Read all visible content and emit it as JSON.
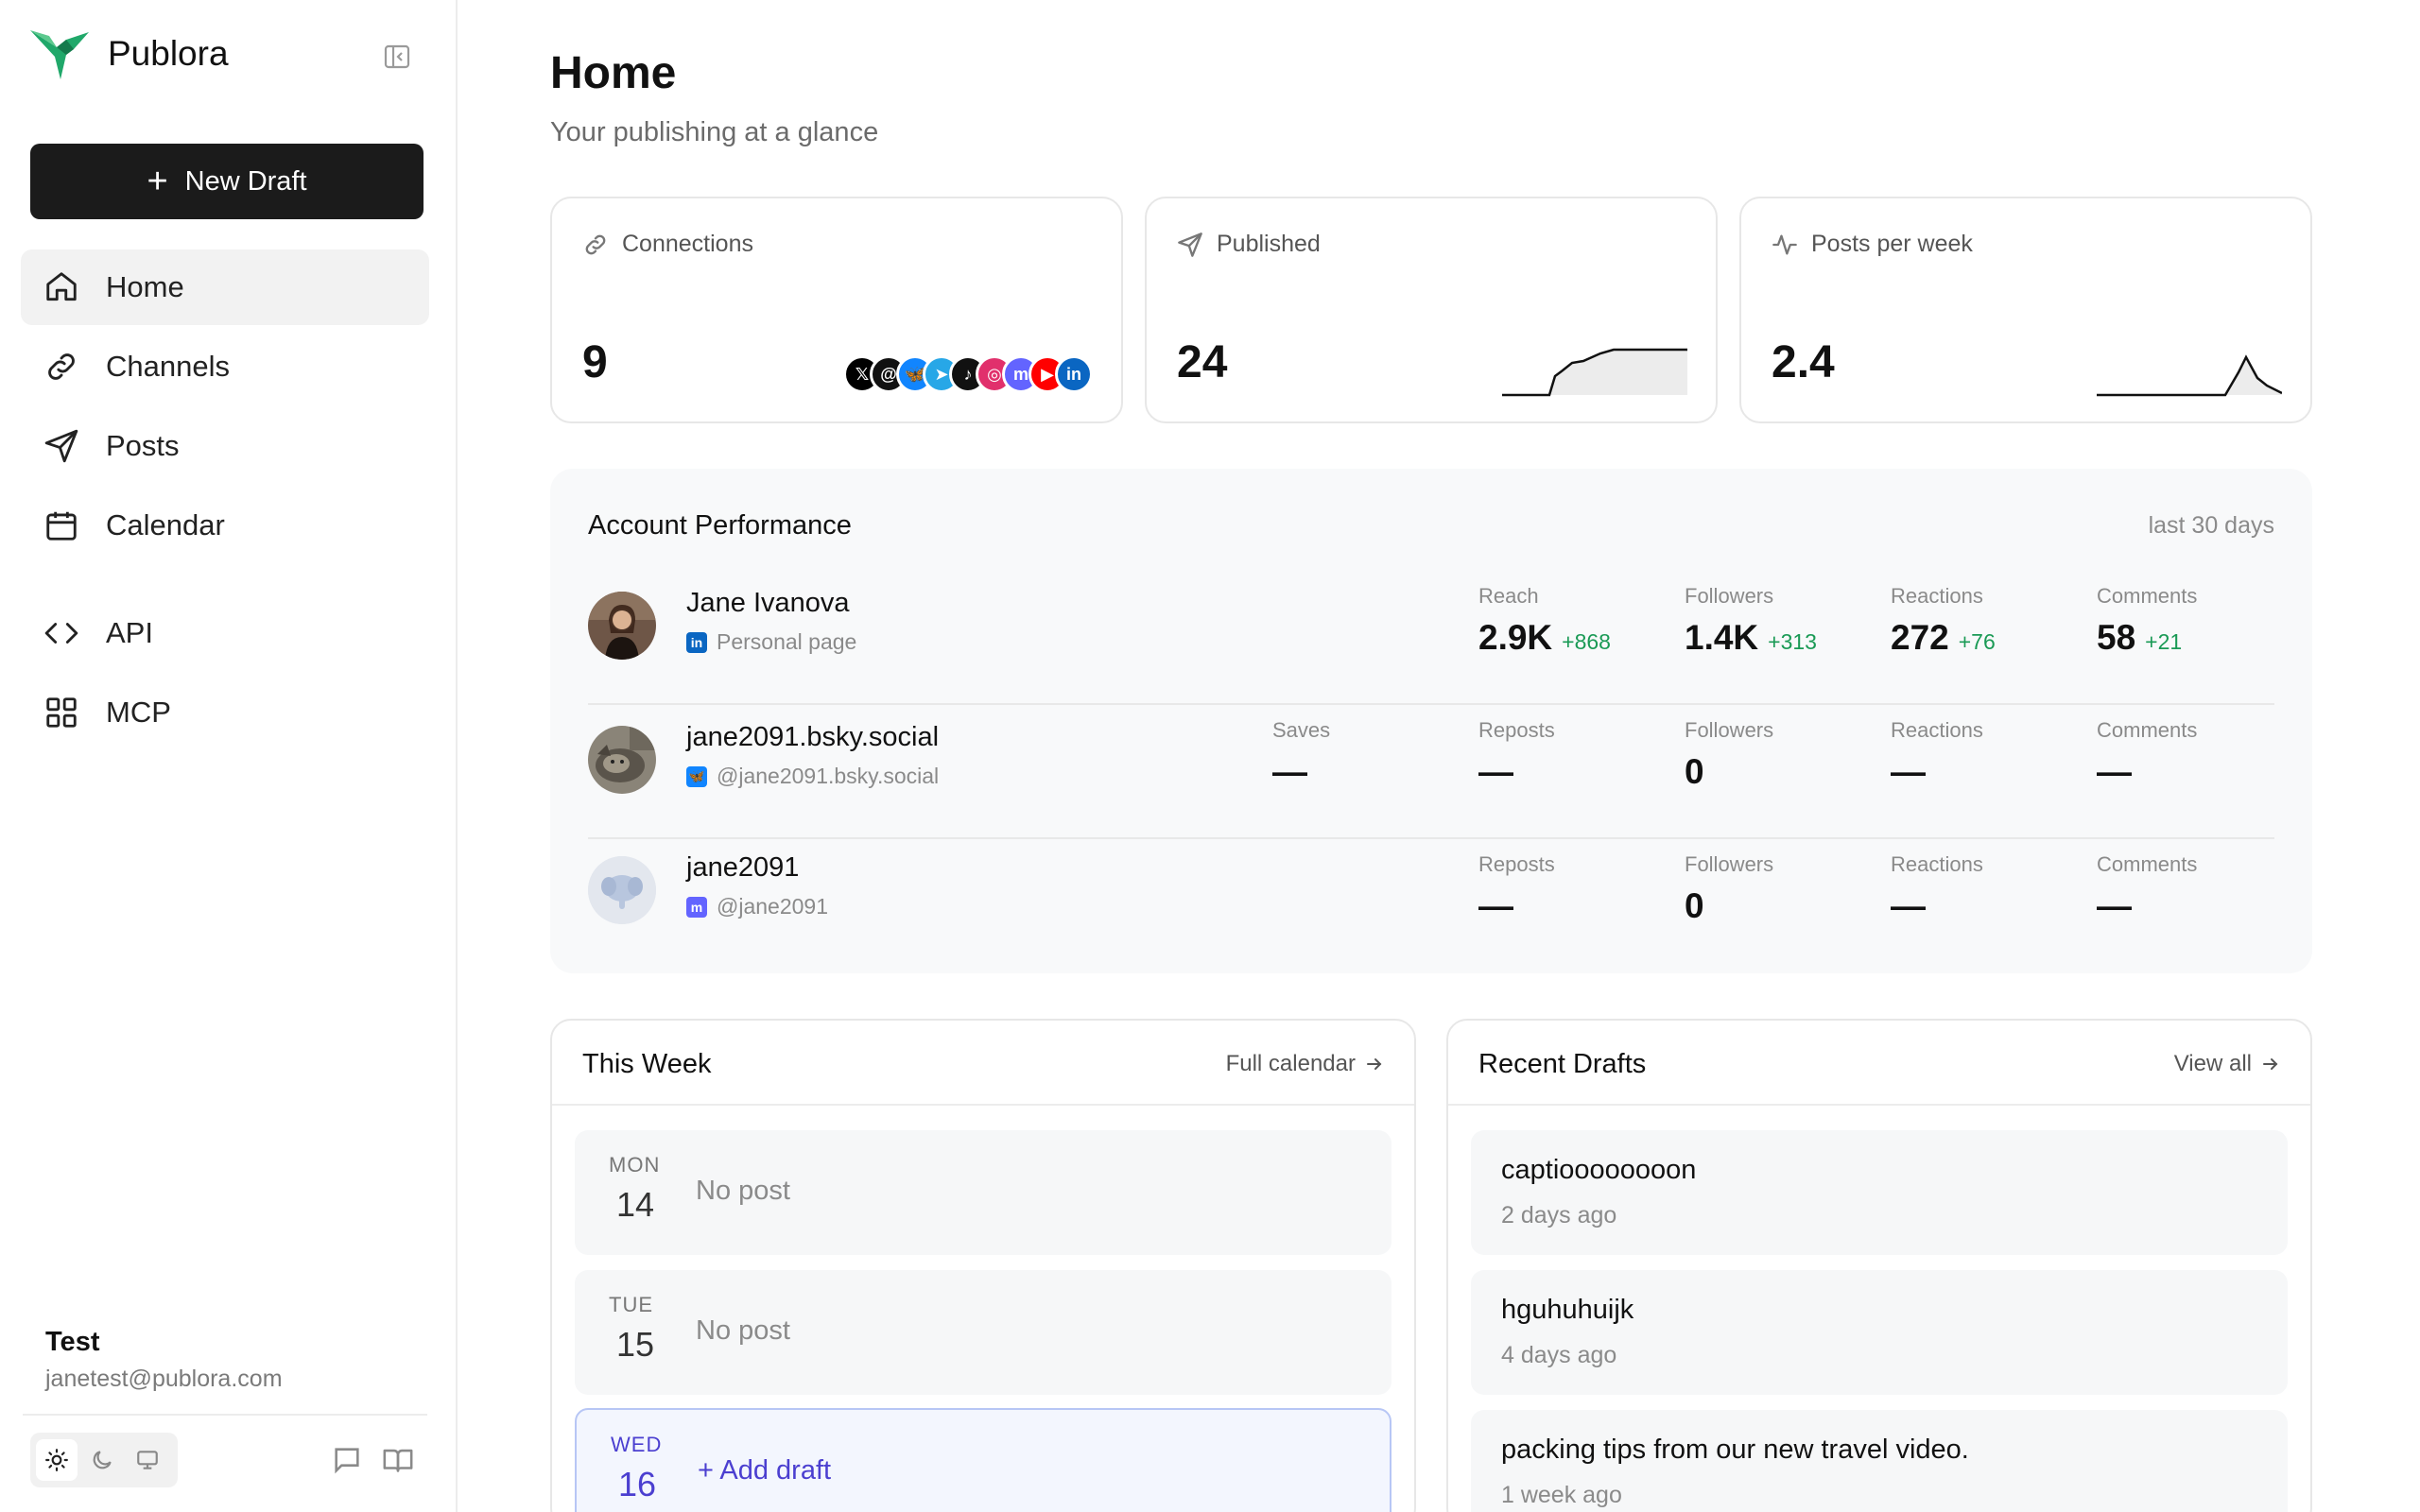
{
  "brand": {
    "name": "Publora"
  },
  "sidebar": {
    "new_draft_label": "New Draft",
    "nav": [
      {
        "label": "Home",
        "icon": "home-icon"
      },
      {
        "label": "Channels",
        "icon": "link-icon"
      },
      {
        "label": "Posts",
        "icon": "send-icon"
      },
      {
        "label": "Calendar",
        "icon": "calendar-icon"
      },
      {
        "label": "API",
        "icon": "code-icon"
      },
      {
        "label": "MCP",
        "icon": "grid-icon"
      }
    ],
    "user": {
      "name": "Test",
      "email": "janetest@publora.com"
    }
  },
  "header": {
    "title": "Home",
    "subtitle": "Your publishing at a glance"
  },
  "stats": [
    {
      "label": "Connections",
      "value": "9",
      "icon": "link-icon"
    },
    {
      "label": "Published",
      "value": "24",
      "icon": "send-icon"
    },
    {
      "label": "Posts per week",
      "value": "2.4",
      "icon": "activity-icon"
    }
  ],
  "connection_icons": [
    {
      "glyph": "𝕏",
      "color": "#000000"
    },
    {
      "glyph": "@",
      "color": "#111111"
    },
    {
      "glyph": "🦋",
      "color": "#1185fe"
    },
    {
      "glyph": "➤",
      "color": "#27a7e7"
    },
    {
      "glyph": "♪",
      "color": "#111111"
    },
    {
      "glyph": "◎",
      "color": "#e1306c"
    },
    {
      "glyph": "m",
      "color": "#6364ff"
    },
    {
      "glyph": "▶",
      "color": "#ff0000"
    },
    {
      "glyph": "in",
      "color": "#0a66c2"
    }
  ],
  "performance": {
    "title": "Account Performance",
    "range": "last 30 days",
    "accounts": [
      {
        "name": "Jane Ivanova",
        "handle": "Personal page",
        "network": "linkedin",
        "metrics": [
          {
            "label": "Reach",
            "value": "2.9K",
            "delta": "+868"
          },
          {
            "label": "Followers",
            "value": "1.4K",
            "delta": "+313"
          },
          {
            "label": "Reactions",
            "value": "272",
            "delta": "+76"
          },
          {
            "label": "Comments",
            "value": "58",
            "delta": "+21"
          }
        ]
      },
      {
        "name": "jane2091.bsky.social",
        "handle": "@jane2091.bsky.social",
        "network": "bluesky",
        "metrics": [
          {
            "label": "Saves",
            "value": "—",
            "delta": ""
          },
          {
            "label": "Reposts",
            "value": "—",
            "delta": ""
          },
          {
            "label": "Followers",
            "value": "0",
            "delta": ""
          },
          {
            "label": "Reactions",
            "value": "—",
            "delta": ""
          },
          {
            "label": "Comments",
            "value": "—",
            "delta": ""
          }
        ]
      },
      {
        "name": "jane2091",
        "handle": "@jane2091",
        "network": "mastodon",
        "metrics": [
          {
            "label": "Reposts",
            "value": "—",
            "delta": ""
          },
          {
            "label": "Followers",
            "value": "0",
            "delta": ""
          },
          {
            "label": "Reactions",
            "value": "—",
            "delta": ""
          },
          {
            "label": "Comments",
            "value": "—",
            "delta": ""
          }
        ]
      }
    ]
  },
  "this_week": {
    "title": "This Week",
    "link": "Full calendar",
    "days": [
      {
        "dow": "MON",
        "num": "14",
        "text": "No post",
        "today": false
      },
      {
        "dow": "TUE",
        "num": "15",
        "text": "No post",
        "today": false
      },
      {
        "dow": "WED",
        "num": "16",
        "text": "+ Add draft",
        "today": true
      }
    ]
  },
  "recent_drafts": {
    "title": "Recent Drafts",
    "link": "View all",
    "items": [
      {
        "title": "captioooooooon",
        "time": "2 days ago"
      },
      {
        "title": "hguhuhuijk",
        "time": "4 days ago"
      },
      {
        "title": "packing tips from our new travel video.",
        "time": "1 week ago"
      }
    ]
  }
}
